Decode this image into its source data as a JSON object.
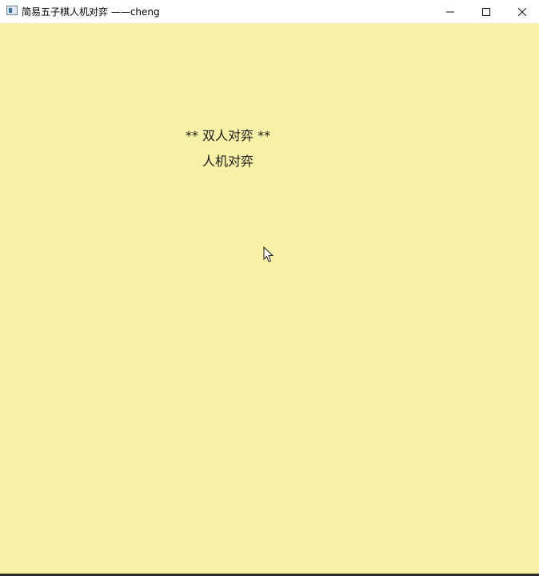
{
  "window": {
    "title": "简易五子棋人机对弈 ——cheng",
    "controls": {
      "minimize": "minimize-icon",
      "maximize": "maximize-icon",
      "close": "close-icon"
    }
  },
  "menu": {
    "items": [
      {
        "label": "** 双人对弈 **",
        "selected": true
      },
      {
        "label": "人机对弈",
        "selected": false
      }
    ]
  },
  "colors": {
    "background": "#f7f0a6",
    "titlebar": "#ffffff",
    "text": "#1b1b1b"
  }
}
